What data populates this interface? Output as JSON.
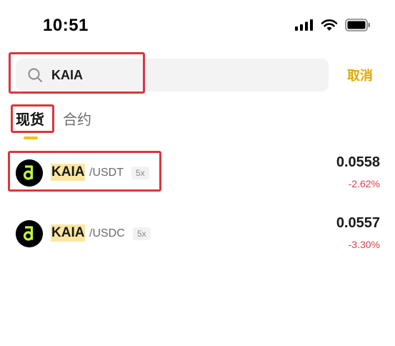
{
  "status_bar": {
    "time": "10:51",
    "icons": [
      "signal-icon",
      "wifi-icon",
      "battery-icon"
    ]
  },
  "search": {
    "value": "KAIA",
    "cancel_label": "取消"
  },
  "tabs": [
    {
      "label": "现货",
      "active": true
    },
    {
      "label": "合约",
      "active": false
    }
  ],
  "results": [
    {
      "base": "KAIA",
      "quote": "/USDT",
      "leverage": "5x",
      "price": "0.0558",
      "change": "-2.62%"
    },
    {
      "base": "KAIA",
      "quote": "/USDC",
      "leverage": "5x",
      "price": "0.0557",
      "change": "-3.30%"
    }
  ],
  "colors": {
    "accent": "#f5c400",
    "cancel": "#e0a800",
    "negative": "#e03c4b",
    "highlight": "#fbe7a1",
    "annotation_box": "#d9363e"
  }
}
